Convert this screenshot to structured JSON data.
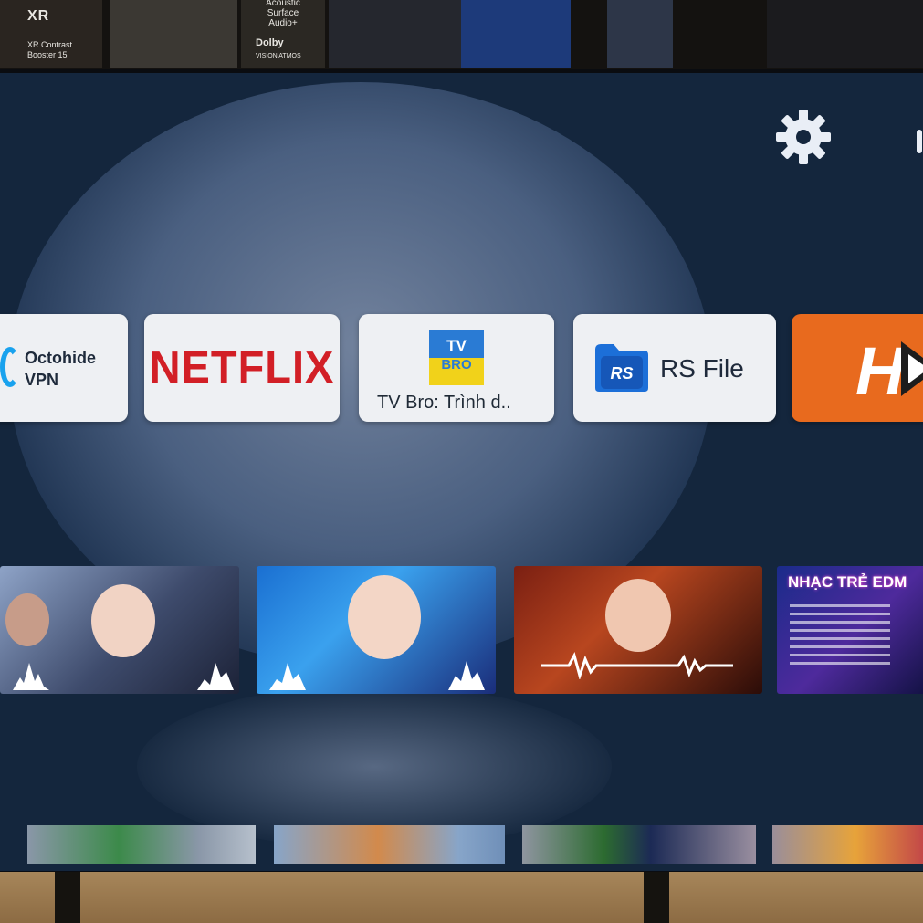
{
  "environment": {
    "box_labels": {
      "xr_logo": "XR",
      "xr_sub": "XR Contrast Booster 15",
      "audio": "Acoustic Surface Audio+",
      "dolby": "Dolby",
      "dolby_sub": "VISION ATMOS"
    }
  },
  "screen": {
    "top_icons": [
      "gear-icon"
    ],
    "apps": [
      {
        "name": "Octohide VPN",
        "line1": "Octohide",
        "line2": "VPN"
      },
      {
        "name": "Netflix",
        "label": "NETFLIX"
      },
      {
        "name": "TV Bro",
        "logo_top": "TV",
        "logo_bottom": "BRO",
        "label": "TV Bro: Trình d.."
      },
      {
        "name": "RS File",
        "logo": "RS",
        "label": "RS File"
      },
      {
        "name": "HD",
        "logo": "H"
      }
    ],
    "videos": [
      {
        "id": "video-1"
      },
      {
        "id": "video-2"
      },
      {
        "id": "video-3"
      },
      {
        "id": "video-4",
        "title": "NHẠC TRẺ EDM"
      }
    ]
  },
  "colors": {
    "netflix_red": "#d21f26",
    "octohide_blue": "#19a2ee",
    "tvbro_blue": "#2a7bd4",
    "tvbro_yellow": "#f1d21a",
    "rs_blue": "#1c6fd8",
    "hd_orange": "#e86a1e"
  }
}
